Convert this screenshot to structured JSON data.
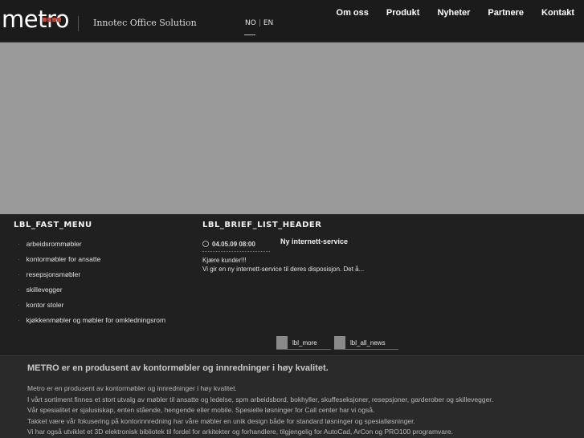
{
  "header": {
    "logo_text": "metro",
    "tagline": "Innotec Office Solution",
    "lang": [
      "NO",
      "EN"
    ],
    "nav": [
      "Om oss",
      "Produkt",
      "Nyheter",
      "Partnere",
      "Kontakt"
    ]
  },
  "fast_menu": {
    "title": "LBL_FAST_MENU",
    "items": [
      "arbeidsrommøbler",
      "kontormøbler for ansatte",
      "resepsjonsmøbler",
      "skillevegger",
      "kontor stoler",
      "kjøkkenmøbler og møbler for omkledningsrom"
    ]
  },
  "brief_list": {
    "title": "LBL_BRIEF_LIST_HEADER",
    "date": "04.05.09 08:00",
    "headline": "Ny internett-service",
    "body": [
      "Kjære kunder!!!",
      "Vi gir en ny internett-service til deres disposisjon. Det å..."
    ],
    "more_label": "lbl_more",
    "all_news_label": "lbl_all_news"
  },
  "footer": {
    "title": "METRO er en produsent av kontormøbler og innredninger i høy kvalitet.",
    "lines": [
      "Metro er en produsent av kontormøbler og innredninger i høy kvalitet.",
      "I vårt sortiment finnes et stort utvalg av møbler til ansatte og ledelse, spm arbeidsbord, bokhyller, skuffeseksjoner, resepsjoner, garderober og skillevegger.",
      "Vår spesialitet er sjalusiskap, enten stående, hengende eller mobile. Spesielle løsninger for Call center har vi også.",
      "Takket være vår fokusering på kontorinnredning har våre møbler en unik design både for standard løsninger og spesialløsninger.",
      "Vi har også utviklet et 3D elektronisk bibliotek til fordel for arkitekter og forhandlere, tilgjengelig for AutoCad, ArCon og PRO100 programvare."
    ]
  }
}
